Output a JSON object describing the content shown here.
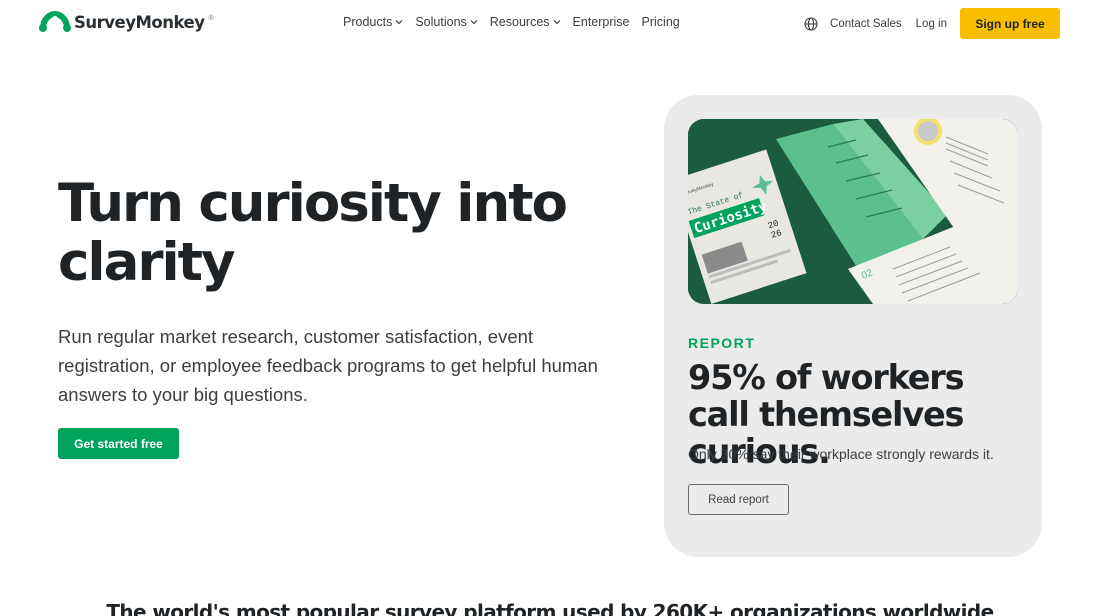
{
  "header": {
    "brand": "SurveyMonkey",
    "brand_mark": "®",
    "nav": [
      {
        "label": "Products",
        "icon": "chevron-down-icon"
      },
      {
        "label": "Solutions",
        "icon": "chevron-down-icon"
      },
      {
        "label": "Resources",
        "icon": "chevron-down-icon"
      },
      {
        "label": "Enterprise"
      },
      {
        "label": "Pricing"
      }
    ],
    "contact_sales": "Contact Sales",
    "log_in": "Log in",
    "sign_up": "Sign up free",
    "globe_icon": "globe-icon"
  },
  "hero": {
    "title": "Turn curiosity into clarity",
    "subtitle": "Run regular market research, customer satisfaction, event registration, or employee feedback programs to get helpful human answers to your big questions.",
    "cta": "Get started free"
  },
  "report_card": {
    "label": "REPORT",
    "title": "95% of workers call themselves curious.",
    "description": "Only 30% say their workplace strongly rewards it.",
    "button": "Read report",
    "image": {
      "cover_brand": "SurveyMonkey",
      "cover_title_top": "The State of",
      "cover_title_main": "Curiosity",
      "cover_year_top": "20",
      "cover_year_bottom": "26",
      "page_number": "02"
    }
  },
  "bottom": {
    "heading": "The world's most popular survey platform used by 260K+ organizations worldwide"
  },
  "colors": {
    "brand_green": "#00a35c",
    "signup_yellow": "#f9be00",
    "card_bg": "#ebebeb",
    "text_dark": "#1f2326"
  }
}
